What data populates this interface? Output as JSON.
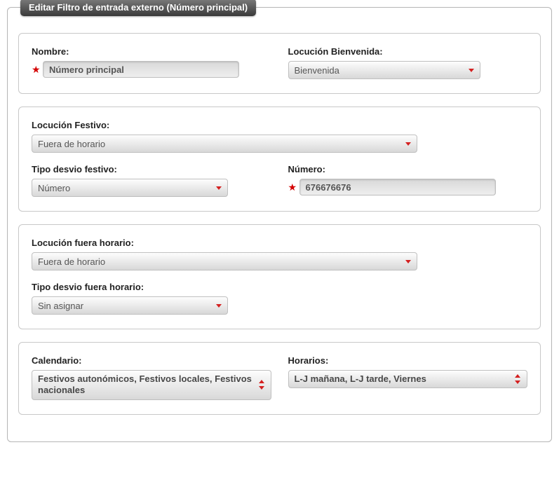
{
  "legend": "Editar Filtro de entrada externo (Número principal)",
  "section1": {
    "nombre": {
      "label": "Nombre:",
      "value": "Número principal"
    },
    "locucion_bienvenida": {
      "label": "Locución Bienvenida:",
      "value": "Bienvenida"
    }
  },
  "section2": {
    "locucion_festivo": {
      "label": "Locución Festivo:",
      "value": "Fuera de horario"
    },
    "tipo_desvio_festivo": {
      "label": "Tipo desvio festivo:",
      "value": "Número"
    },
    "numero": {
      "label": "Número:",
      "value": "676676676"
    }
  },
  "section3": {
    "locucion_fuera_horario": {
      "label": "Locución fuera horario:",
      "value": "Fuera de horario"
    },
    "tipo_desvio_fuera_horario": {
      "label": "Tipo desvio fuera horario:",
      "value": "Sin asignar"
    }
  },
  "section4": {
    "calendario": {
      "label": "Calendario:",
      "value": "Festivos autonómicos, Festivos locales, Festivos nacionales"
    },
    "horarios": {
      "label": "Horarios:",
      "value": "L-J mañana, L-J tarde, Viernes"
    }
  }
}
